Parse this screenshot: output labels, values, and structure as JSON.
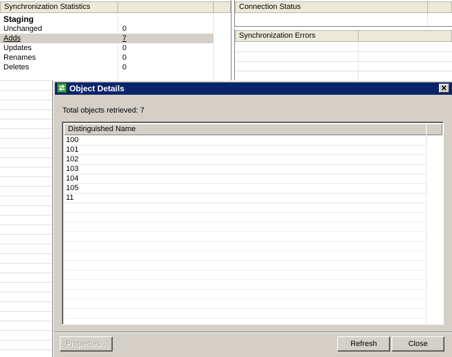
{
  "stats": {
    "header": "Synchronization Statistics",
    "section": "Staging",
    "rows": [
      {
        "label": "Unchanged",
        "value": "0"
      },
      {
        "label": "Adds",
        "value": "7"
      },
      {
        "label": "Updates",
        "value": "0"
      },
      {
        "label": "Renames",
        "value": "0"
      },
      {
        "label": "Deletes",
        "value": "0"
      }
    ]
  },
  "connection": {
    "header": "Connection Status"
  },
  "errors": {
    "header": "Synchronization Errors"
  },
  "dialog": {
    "title": "Object Details",
    "total_text": "Total objects retrieved: 7",
    "column_header": "Distinguished Name",
    "items": [
      "100",
      "101",
      "102",
      "103",
      "104",
      "105",
      "11"
    ],
    "buttons": {
      "properties": "Properties...",
      "refresh": "Refresh",
      "close": "Close"
    }
  },
  "colors": {
    "titlebar": "#0a246a",
    "selected_row": "#d4d0c8",
    "dialog_face": "#d4d0c8"
  }
}
